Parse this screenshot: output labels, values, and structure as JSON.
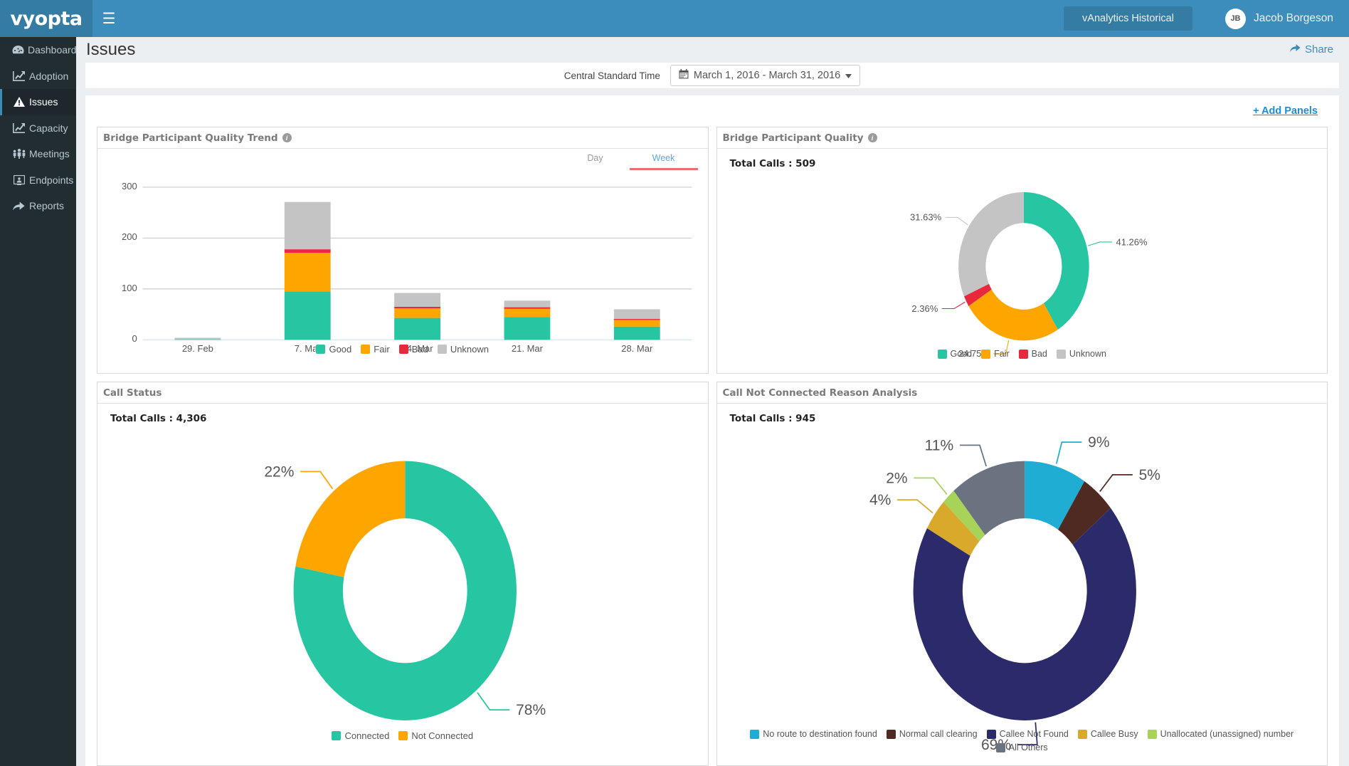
{
  "topbar": {
    "logo": "vyopta",
    "menu_icon": "hamburger-icon",
    "product_button": "vAnalytics Historical",
    "user_initials": "JB",
    "user_name": "Jacob Borgeson"
  },
  "sidebar": {
    "items": [
      {
        "label": "Dashboard",
        "icon": "dashboard-icon",
        "active": false
      },
      {
        "label": "Adoption",
        "icon": "chart-line-icon",
        "active": false
      },
      {
        "label": "Issues",
        "icon": "warning-triangle-icon",
        "active": true
      },
      {
        "label": "Capacity",
        "icon": "chart-line-icon",
        "active": false
      },
      {
        "label": "Meetings",
        "icon": "users-icon",
        "active": false
      },
      {
        "label": "Endpoints",
        "icon": "desktop-icon",
        "active": false
      },
      {
        "label": "Reports",
        "icon": "share-arrow-icon",
        "active": false
      }
    ]
  },
  "page": {
    "title": "Issues",
    "share_label": "Share",
    "add_panels_label": "+ Add Panels"
  },
  "date_bar": {
    "timezone": "Central Standard Time",
    "range": "March 1, 2016 - March 31, 2016",
    "calendar_icon": "calendar-icon",
    "caret_icon": "caret-down-icon"
  },
  "colors": {
    "brand_blue": "#3c8dbc",
    "sidebar_dark": "#222d32",
    "good": "#26c6a2",
    "fair": "#ffa500",
    "bad": "#e8283c",
    "unknown": "#c4c4c4",
    "link": "#1b8fd6",
    "active_underline": "#ef6d6d"
  },
  "panels": [
    {
      "title": "Bridge Participant Quality Trend",
      "has_info": true,
      "toggle": {
        "options": [
          "Day",
          "Week"
        ],
        "selected": "Week"
      }
    },
    {
      "title": "Bridge Participant Quality",
      "has_info": true,
      "total_label": "Total Calls : 509"
    },
    {
      "title": "Call Status",
      "has_info": false,
      "total_label": "Total Calls : 4,306"
    },
    {
      "title": "Call Not Connected Reason Analysis",
      "has_info": false,
      "total_label": "Total Calls : 945"
    }
  ],
  "chart_data": [
    {
      "id": "bridge-participant-quality-trend",
      "type": "bar",
      "stacked": true,
      "title": "Bridge Participant Quality Trend",
      "xlabel": "",
      "ylabel": "",
      "ylim": [
        0,
        320
      ],
      "yticks": [
        0,
        100,
        200,
        300
      ],
      "grid": true,
      "legend_position": "bottom",
      "categories": [
        "29. Feb",
        "7. Mar",
        "14. Mar",
        "21. Mar",
        "28. Mar"
      ],
      "series": [
        {
          "name": "Good",
          "color": "#26c6a2",
          "values": [
            1,
            95,
            43,
            45,
            26
          ]
        },
        {
          "name": "Fair",
          "color": "#ffa500",
          "values": [
            0,
            76,
            19,
            16,
            13
          ]
        },
        {
          "name": "Bad",
          "color": "#e8283c",
          "values": [
            0,
            7,
            3,
            3,
            2
          ]
        },
        {
          "name": "Unknown",
          "color": "#c4c4c4",
          "values": [
            3,
            93,
            27,
            13,
            19
          ]
        }
      ]
    },
    {
      "id": "bridge-participant-quality",
      "type": "pie",
      "donut": true,
      "title": "Bridge Participant Quality",
      "total_calls": 509,
      "legend_position": "bottom",
      "labels": [
        "Good",
        "Fair",
        "Bad",
        "Unknown"
      ],
      "values": [
        41.26,
        24.75,
        2.36,
        31.63
      ],
      "value_labels": [
        "41.26%",
        "24.75%",
        "2.36%",
        "31.63%"
      ],
      "colors": [
        "#26c6a2",
        "#ffa500",
        "#e8283c",
        "#c4c4c4"
      ]
    },
    {
      "id": "call-status",
      "type": "pie",
      "donut": true,
      "title": "Call Status",
      "total_calls": 4306,
      "legend_position": "bottom",
      "labels": [
        "Connected",
        "Not Connected"
      ],
      "values": [
        78,
        22
      ],
      "value_labels": [
        "78%",
        "22%"
      ],
      "colors": [
        "#26c6a2",
        "#ffa500"
      ]
    },
    {
      "id": "call-not-connected-reason-analysis",
      "type": "pie",
      "donut": true,
      "title": "Call Not Connected Reason Analysis",
      "total_calls": 945,
      "legend_position": "bottom",
      "labels": [
        "No route to destination found",
        "Normal call clearing",
        "Callee Not Found",
        "Callee Busy",
        "Unallocated (unassigned) number",
        "All Others"
      ],
      "values": [
        9,
        5,
        69,
        4,
        2,
        11
      ],
      "value_labels": [
        "9%",
        "5%",
        "69%",
        "4%",
        "2%",
        "11%"
      ],
      "colors": [
        "#1fadd4",
        "#4e2a22",
        "#2b2a6b",
        "#d9a92b",
        "#a8d359",
        "#6b7280"
      ]
    }
  ]
}
